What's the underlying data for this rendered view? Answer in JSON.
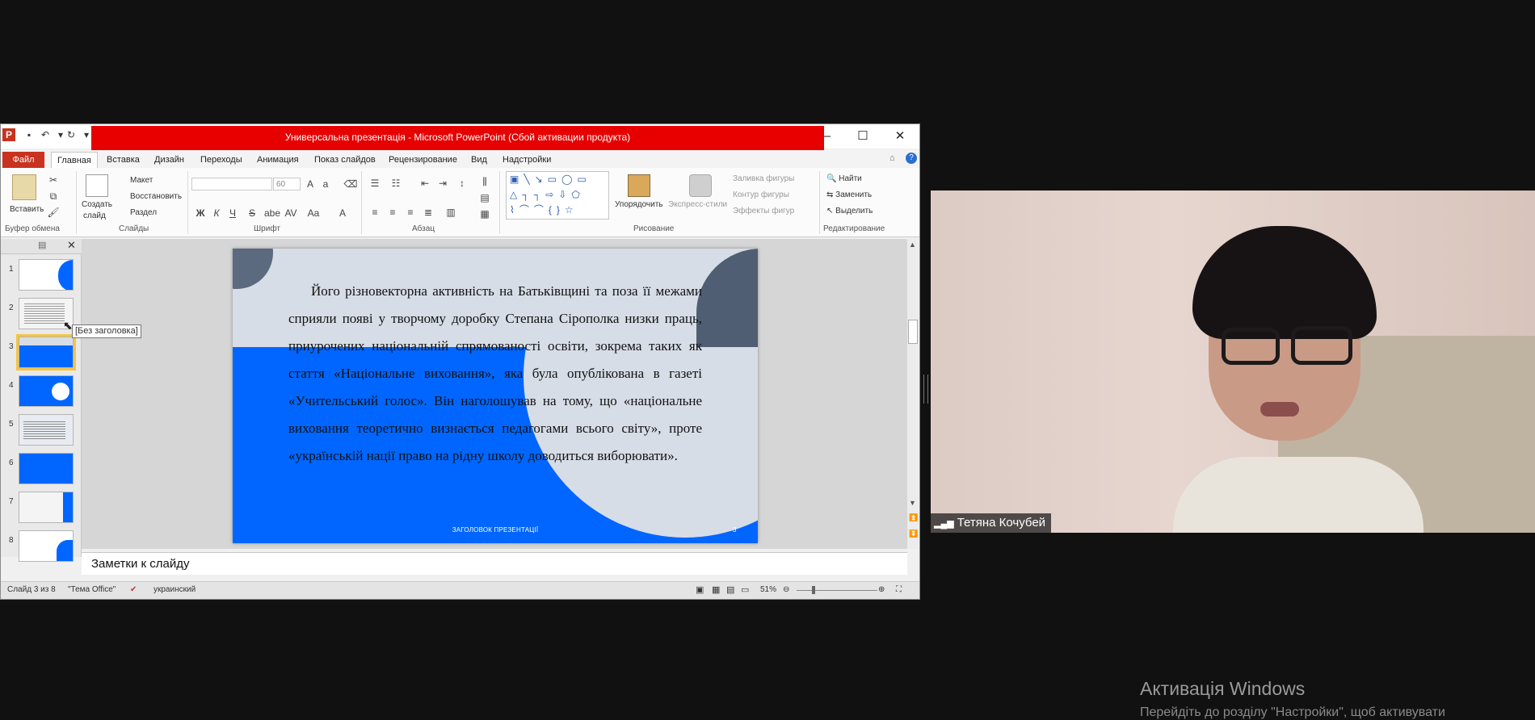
{
  "window": {
    "title": "Универсальна презентація - Microsoft PowerPoint (Сбой активации продукта)",
    "buttons": {
      "minimize": "–",
      "maximize": "☐",
      "close": "✕"
    }
  },
  "ribbon": {
    "tabs": [
      "Файл",
      "Главная",
      "Вставка",
      "Дизайн",
      "Переходы",
      "Анимация",
      "Показ слайдов",
      "Рецензирование",
      "Вид",
      "Надстройки"
    ],
    "active_tab": "Главная",
    "clipboard": {
      "paste": "Вставить",
      "group": "Буфер обмена"
    },
    "slides": {
      "create": "Создать",
      "create2": "слайд",
      "layout": "Макет",
      "reset": "Восстановить",
      "section": "Раздел",
      "group": "Слайды"
    },
    "font": {
      "size": "60",
      "group": "Шрифт"
    },
    "paragraph": {
      "group": "Абзац"
    },
    "drawing": {
      "arrange": "Упорядочить",
      "quick_styles": "Экспресс-стили",
      "fill": "Заливка фигуры",
      "outline": "Контур фигуры",
      "effects": "Эффекты фигур",
      "group": "Рисование"
    },
    "editing": {
      "find": "Найти",
      "replace": "Заменить",
      "select": "Выделить",
      "group": "Редактирование"
    }
  },
  "thumbnails": {
    "numbers": [
      "1",
      "2",
      "3",
      "4",
      "5",
      "6",
      "7",
      "8"
    ],
    "selected": "3"
  },
  "tooltip": "[Без заголовка]",
  "slide": {
    "body": "Його різновекторна активність на Батьківщині та поза її межами сприяли появі у творчому доробку Степана Сірополка низки праць, приурочених національній спрямованості освіти, зокрема таких як стаття «Національне виховання», яка була опублікована в газеті «Учительський голос». Він наголошував на тому, що «національне виховання теоретично визнається педагогами всього світу», проте «українській нації право на рідну школу доводиться виборювати».",
    "footer": "ЗАГОЛОВОК ПРЕЗЕНТАЦІЇ",
    "number": "3"
  },
  "notes_placeholder": "Заметки к слайду",
  "status": {
    "slide": "Слайд 3 из 8",
    "theme": "\"Тема Office\"",
    "language": "украинский",
    "zoom": "51%"
  },
  "video": {
    "participant": "Тетяна Кочубей"
  },
  "watermark": {
    "title": "Активація Windows",
    "subtitle": "Перейдіть до розділу \"Настройки\", щоб активувати"
  },
  "colors": {
    "slide_blue": "#0066ff",
    "title_red": "#e60000",
    "file_tab": "#c8321f"
  }
}
